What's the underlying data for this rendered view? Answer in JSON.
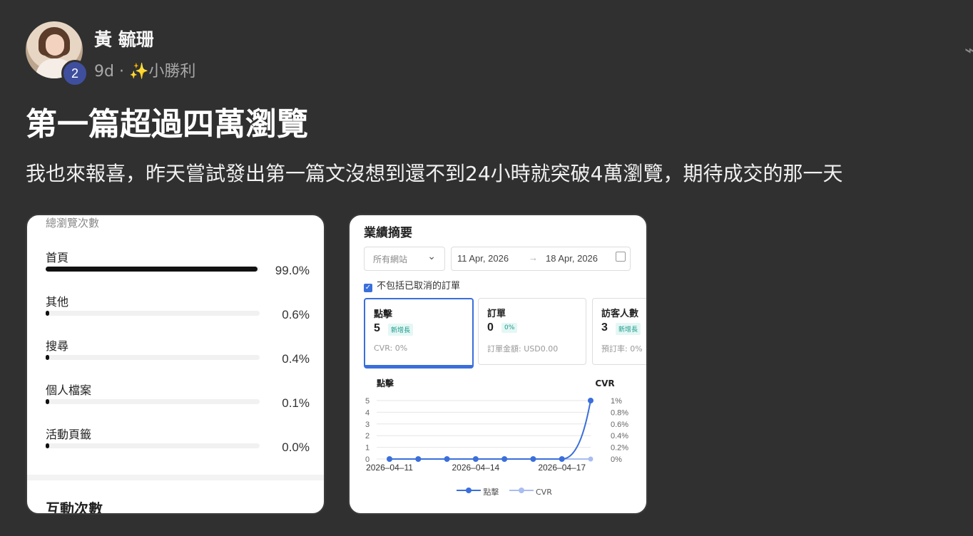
{
  "post": {
    "author": "黃 毓珊",
    "badge": "2",
    "time": "9d",
    "dot": "·",
    "sparkle": "✨",
    "tag": "小勝利",
    "title": "第一篇超過四萬瀏覽",
    "body": "我也來報喜，昨天嘗試發出第一篇文沒想到還不到24小時就突破4萬瀏覽，期待成交的那一天"
  },
  "card1": {
    "top_label": "總瀏覽次數",
    "stats": [
      {
        "label": "首頁",
        "percent": "99.0%",
        "fill": 0.99
      },
      {
        "label": "其他",
        "percent": "0.6%",
        "fill": 0.006
      },
      {
        "label": "搜尋",
        "percent": "0.4%",
        "fill": 0.004
      },
      {
        "label": "個人檔案",
        "percent": "0.1%",
        "fill": 0.001
      },
      {
        "label": "活動頁籤",
        "percent": "0.0%",
        "fill": 0.0
      }
    ],
    "bottom_label": "互動次數"
  },
  "card2": {
    "title": "業績摘要",
    "site_select": "所有網站",
    "date_from": "11 Apr, 2026",
    "date_to": "18 Apr, 2026",
    "date_arrow": "→",
    "exclude_cancelled": "不包括已取消的訂單",
    "kpis": [
      {
        "label": "點擊",
        "value": "5",
        "tag": "新增長",
        "sub": "CVR: 0%"
      },
      {
        "label": "訂單",
        "value": "0",
        "tag": "0%",
        "sub": "訂單金額: USD0.00"
      },
      {
        "label": "訪客人數",
        "value": "3",
        "tag": "新增長",
        "sub": "預訂率: 0%"
      }
    ]
  },
  "chart_data": {
    "type": "line",
    "ylabel_left": "點擊",
    "ylabel_right": "CVR",
    "x": [
      "2026-04-11",
      "2026-04-12",
      "2026-04-13",
      "2026-04-14",
      "2026-04-15",
      "2026-04-16",
      "2026-04-17",
      "2026-04-18"
    ],
    "x_tick_labels": [
      "2026–04–11",
      "2026–04–14",
      "2026–04–17"
    ],
    "y_left_ticks": [
      "0",
      "1",
      "2",
      "3",
      "4",
      "5"
    ],
    "y_right_ticks": [
      "0%",
      "0.2%",
      "0.4%",
      "0.6%",
      "0.8%",
      "1%"
    ],
    "ylim_left": [
      0,
      5
    ],
    "ylim_right": [
      0,
      1
    ],
    "series": [
      {
        "name": "點擊",
        "axis": "left",
        "color": "#3a6fdb",
        "values": [
          0,
          0,
          0,
          0,
          0,
          0,
          0,
          5
        ]
      },
      {
        "name": "CVR",
        "axis": "right",
        "color": "#a9bdf0",
        "values": [
          0,
          0,
          0,
          0,
          0,
          0,
          0,
          0
        ]
      }
    ],
    "grid": true,
    "legend": "bottom"
  }
}
